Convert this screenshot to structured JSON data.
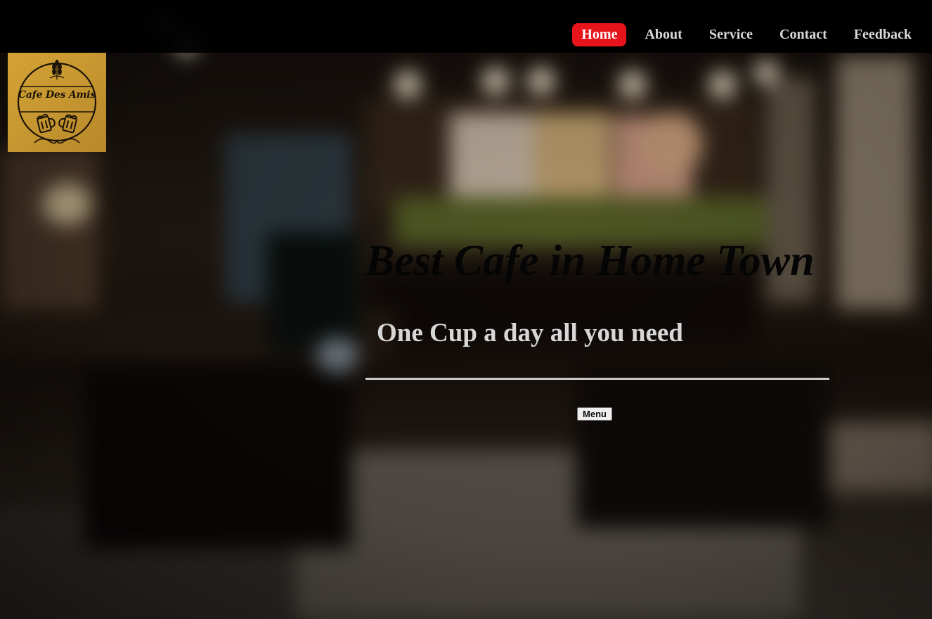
{
  "nav": {
    "items": [
      {
        "label": "Home",
        "active": true
      },
      {
        "label": "About",
        "active": false
      },
      {
        "label": "Service",
        "active": false
      },
      {
        "label": "Contact",
        "active": false
      },
      {
        "label": "Feedback",
        "active": false
      }
    ]
  },
  "logo": {
    "text": "Cafe Des Amis",
    "icons": [
      "wheat-icon",
      "beer-mugs-icon",
      "flourish-icon"
    ]
  },
  "hero": {
    "title": "Best Cafe in Home Town",
    "subtitle": "One Cup a day all you need",
    "menu_button": "Menu"
  },
  "colors": {
    "nav_active_bg": "#e8141c",
    "logo_bg": "#c99a32",
    "title_color": "#050505",
    "subtitle_color": "#d7d7d7"
  }
}
